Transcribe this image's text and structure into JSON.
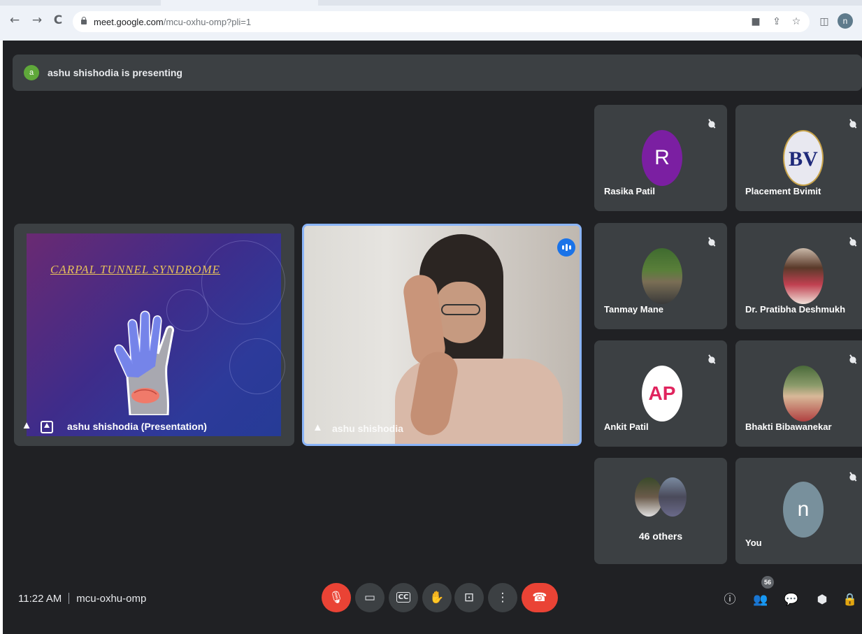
{
  "browser": {
    "url_host": "meet.google.com",
    "url_path": "/mcu-oxhu-omp?pli=1",
    "back_icon": "←",
    "forward_icon": "→",
    "reload_icon": "C",
    "profile_initial": "n"
  },
  "presenting_banner": {
    "avatar_initial": "a",
    "text": "ashu shishodia is presenting"
  },
  "presentation_tile": {
    "slide_title": "CARPAL TUNNEL SYNDROME",
    "label": "ashu shishodia (Presentation)"
  },
  "speaker_tile": {
    "name": "ashu shishodia"
  },
  "participants": [
    {
      "name": "Rasika Patil",
      "initial": "R",
      "avatar_color": "#7b1fa2"
    },
    {
      "name": "Placement Bvimit",
      "initial": "BV",
      "avatar_color": "#e8e8f0"
    },
    {
      "name": "Tanmay Mane",
      "initial": "",
      "avatar_color": "#4a6b3a"
    },
    {
      "name": "Dr. Pratibha Deshmukh",
      "initial": "",
      "avatar_color": "#8a6a5a"
    },
    {
      "name": "Ankit Patil",
      "initial": "AP",
      "avatar_color": "#ffffff"
    },
    {
      "name": "Bhakti Bibawanekar",
      "initial": "",
      "avatar_color": "#6a7a4a"
    },
    {
      "name": "You",
      "initial": "n",
      "avatar_color": "#78909c"
    }
  ],
  "others": {
    "label": "46 others"
  },
  "bottom_bar": {
    "time": "11:22 AM",
    "meeting_code": "mcu-oxhu-omp",
    "people_count": "56"
  }
}
